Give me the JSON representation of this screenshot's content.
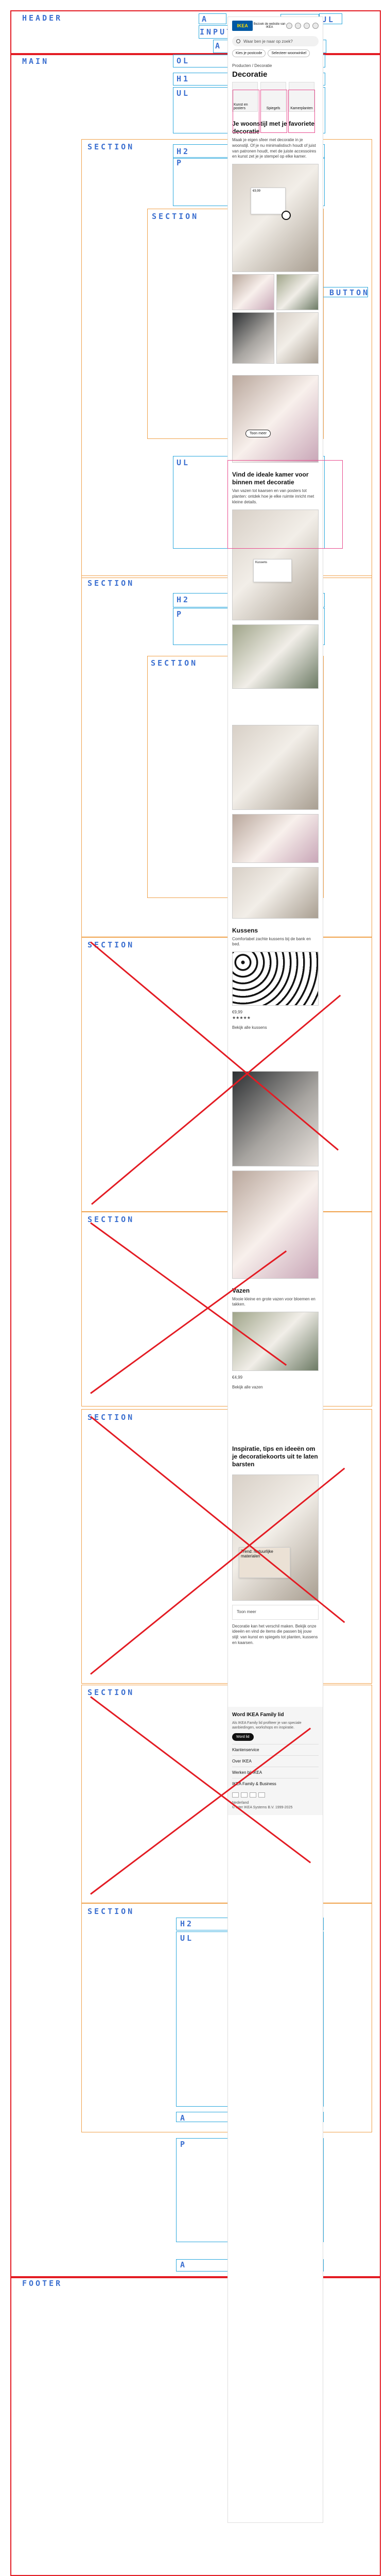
{
  "labels": {
    "header": "HEADER",
    "a1": "A",
    "a2": "A",
    "a3": "A",
    "ul": "UL",
    "input": "INPUT",
    "main": "MAIN",
    "ol": "OL",
    "h1": "H1",
    "ul_main": "UL",
    "section": "SECTION",
    "h2": "H2",
    "p": "P",
    "button": "BUTTON",
    "footer": "FOOTER"
  },
  "mobile": {
    "logo": "IKEA",
    "top_menu_text": "Bezoek de website van IKEA",
    "search_placeholder": "Waar ben je naar op zoek?",
    "top_buttons": [
      "Kies je postcode",
      "Selecteer woonwinkel"
    ],
    "breadcrumb": "Producten  /  Decoratie",
    "page_title": "Decoratie",
    "categories": [
      "Kunst en posters",
      "Spiegels",
      "Kamerplanten"
    ],
    "section1_title": "Je woonstijl met je favoriete decoratie",
    "section1_text": "Maak je eigen sfeer met decoratie in je woonstijl. Of je nu minimalistisch houdt of juist van patronen houdt, met de juiste accessoires en kunst zet je je stempel op elke kamer.",
    "section2_title": "Vind de ideale kamer voor binnen met decoratie",
    "section2_text": "Van vazen tot kaarsen en van posters tot planten: ontdek hoe je elke ruimte inricht met kleine details.",
    "products": {
      "kussens_title": "Kussens",
      "kussens_text": "Comfortabel zachte kussens bij de bank en bed.",
      "kussen_price": "€9,99",
      "kussen_rating": "★★★★★",
      "more": "Bekijk alle kussens",
      "vazen_title": "Vazen",
      "vazen_text": "Mooie kleine en grote vazen voor bloemen en takken.",
      "vaas_price": "€4,99",
      "vaas_more": "Bekijk alle vazen"
    },
    "inspiration_title": "Inspiratie, tips en ideeën om je decoratiekoorts uit te laten barsten",
    "inspiration_card": "Trend: Natuurlijke materialen",
    "inspiration_button": "Toon meer",
    "paragraph_long": "Decoratie kan het verschil maken. Bekijk onze ideeën en vind de items die passen bij jouw stijl: van kunst en spiegels tot planten, kussens en kaarsen.",
    "footer_head": "Word IKEA Family lid",
    "footer_text": "Als IKEA Family lid profiteer je van speciale aanbiedingen, workshops en inspiratie.",
    "footer_button": "Word lid",
    "footer_items": [
      "Klantenservice",
      "Over IKEA",
      "Werken bij IKEA",
      "IKEA Family & Business"
    ],
    "footer_small": "© Inter IKEA Systems B.V. 1999-2025",
    "country": "Nederland"
  }
}
